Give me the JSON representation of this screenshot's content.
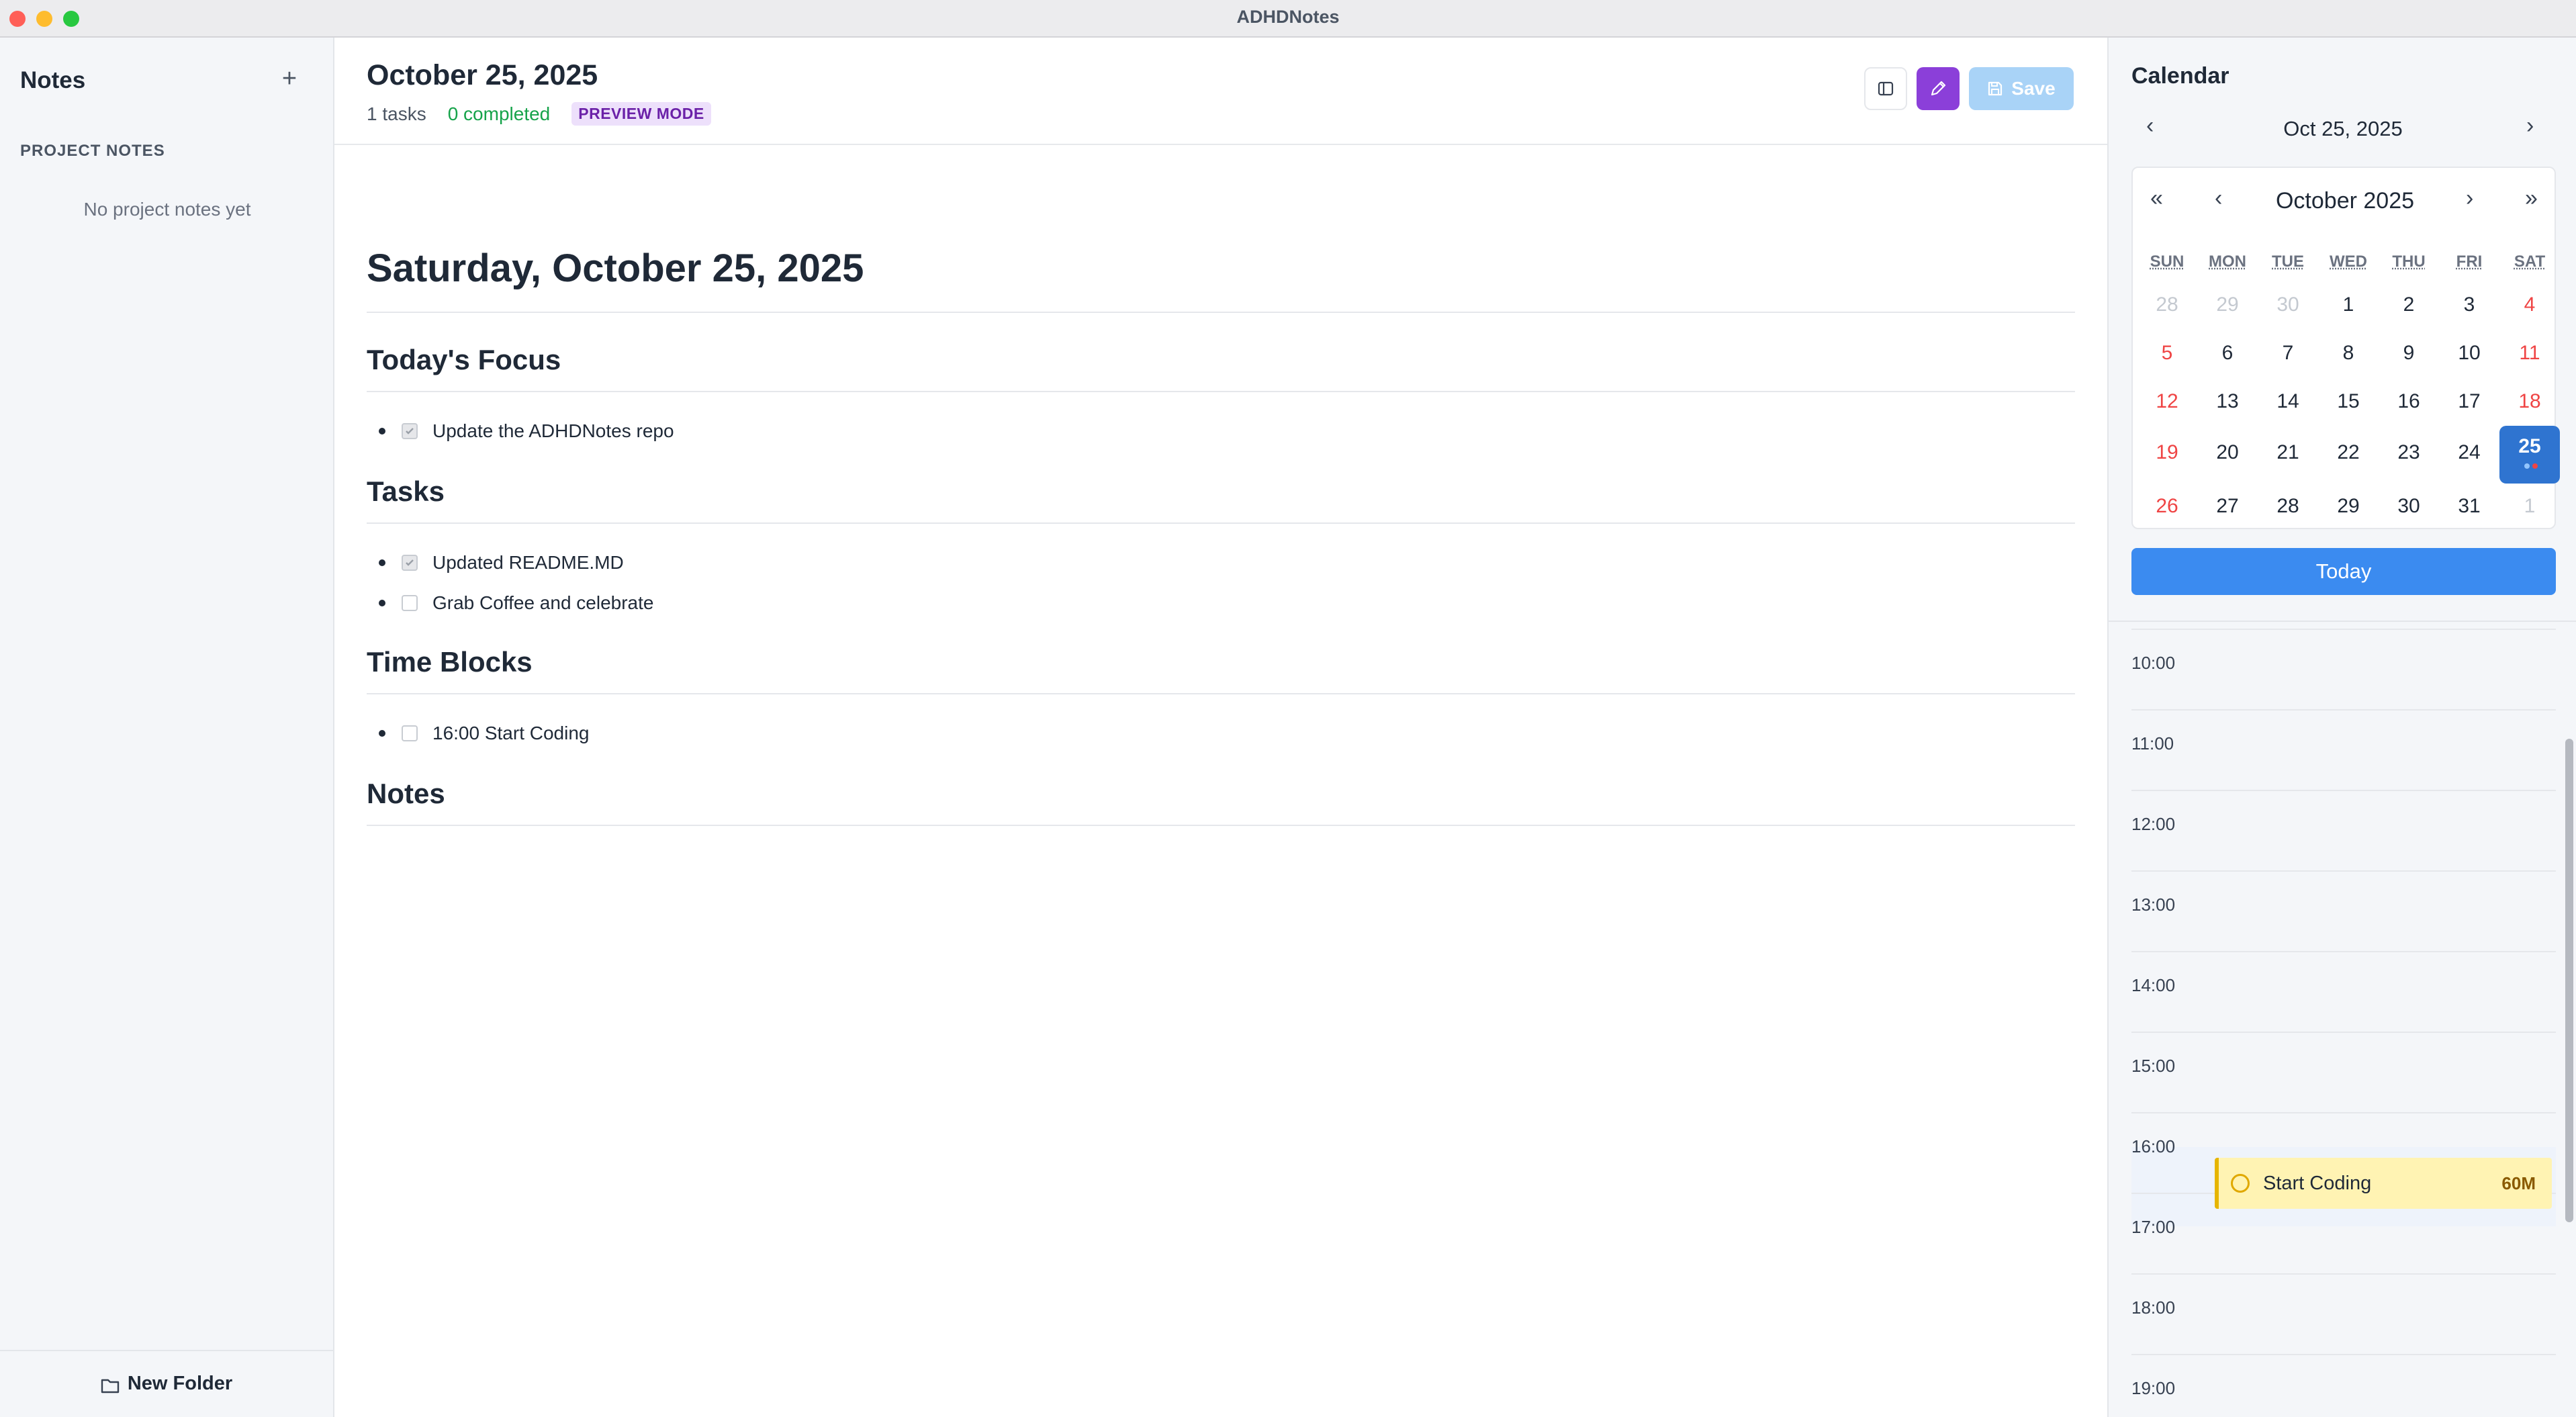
{
  "window": {
    "title": "ADHDNotes"
  },
  "sidebar": {
    "title": "Notes",
    "add_icon": "plus-icon",
    "section_label": "PROJECT NOTES",
    "empty_text": "No project notes yet",
    "footer_button": "New Folder"
  },
  "header": {
    "date": "October 25, 2025",
    "task_count": "1 tasks",
    "completed": "0 completed",
    "mode_badge": "PREVIEW MODE",
    "save_label": "Save"
  },
  "document": {
    "title": "Saturday, October 25, 2025",
    "sections": [
      {
        "heading": "Today's Focus",
        "items": [
          {
            "text": "Update the ADHDNotes repo",
            "checked": true
          }
        ]
      },
      {
        "heading": "Tasks",
        "items": [
          {
            "text": "Updated README.MD",
            "checked": true
          },
          {
            "text": "Grab Coffee and celebrate",
            "checked": false
          }
        ]
      },
      {
        "heading": "Time Blocks",
        "items": [
          {
            "text": "16:00 Start Coding",
            "checked": false
          }
        ]
      },
      {
        "heading": "Notes",
        "items": []
      }
    ]
  },
  "calendar": {
    "title": "Calendar",
    "current_date": "Oct 25, 2025",
    "prev_day": "‹",
    "next_day": "›",
    "month_label": "October 2025",
    "nav": {
      "prev_year": "«",
      "prev_month": "‹",
      "next_month": "›",
      "next_year": "»"
    },
    "weekdays": [
      "SUN",
      "MON",
      "TUE",
      "WED",
      "THU",
      "FRI",
      "SAT"
    ],
    "weeks": [
      [
        "28",
        "29",
        "30",
        "1",
        "2",
        "3",
        "4"
      ],
      [
        "5",
        "6",
        "7",
        "8",
        "9",
        "10",
        "11"
      ],
      [
        "12",
        "13",
        "14",
        "15",
        "16",
        "17",
        "18"
      ],
      [
        "19",
        "20",
        "21",
        "22",
        "23",
        "24",
        "25"
      ],
      [
        "26",
        "27",
        "28",
        "29",
        "30",
        "31",
        "1"
      ]
    ],
    "selected_day": "25",
    "today_button": "Today",
    "hours": [
      "10:00",
      "11:00",
      "12:00",
      "13:00",
      "14:00",
      "15:00",
      "16:00",
      "17:00",
      "18:00",
      "19:00"
    ],
    "event": {
      "title": "Start Coding",
      "duration": "60M",
      "hour": "16:00"
    },
    "colors": {
      "accent": "#3b8bf0",
      "selected": "#2f74d0",
      "weekend": "#ef4444",
      "event_bg": "#fff3b3",
      "edit_button": "#8b3fd9"
    }
  }
}
